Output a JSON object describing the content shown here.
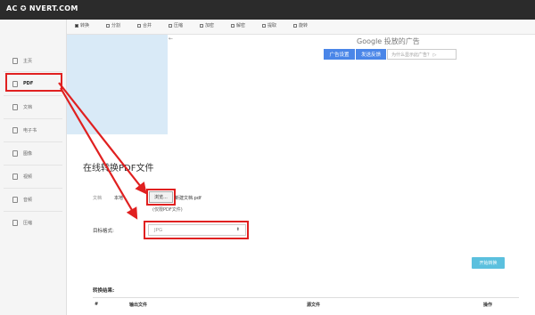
{
  "brand": "AC ✪ NVERT.COM",
  "tabs": [
    {
      "label": "转换",
      "active": true
    },
    {
      "label": "分割",
      "active": false
    },
    {
      "label": "合并",
      "active": false
    },
    {
      "label": "压缩",
      "active": false
    },
    {
      "label": "加密",
      "active": false
    },
    {
      "label": "解密",
      "active": false
    },
    {
      "label": "提取",
      "active": false
    },
    {
      "label": "旋转",
      "active": false
    }
  ],
  "sidebar": {
    "items": [
      {
        "label": "主页",
        "icon": "home-icon"
      },
      {
        "label": "PDF",
        "icon": "pdf-file-icon"
      },
      {
        "label": "文档",
        "icon": "document-icon"
      },
      {
        "label": "电子书",
        "icon": "ebook-icon"
      },
      {
        "label": "图像",
        "icon": "image-icon"
      },
      {
        "label": "视频",
        "icon": "video-icon"
      },
      {
        "label": "音频",
        "icon": "audio-icon"
      },
      {
        "label": "压缩",
        "icon": "archive-icon"
      }
    ]
  },
  "ad": {
    "google": "Google 投放的广告",
    "settings_btn": "广告设置",
    "feedback_btn": "发送反馈",
    "why_text": "为什么显示此广告？ ▷"
  },
  "main": {
    "title": "在线转换PDF文件",
    "source_seg1": "文档",
    "source_seg2": "本地",
    "browse_btn": "浏览...",
    "file_name": "新建文档.pdf",
    "file_hint": "(仅限PDF文件)",
    "target_label": "目标格式:",
    "target_value": "JPG",
    "start_btn": "开始转换",
    "result_label": "转换结果:",
    "table_headers": [
      "#",
      "输出文件",
      "源文件",
      "操作"
    ]
  },
  "colors": {
    "highlight": "#e02020",
    "accent": "#5bc0de",
    "ad_blue": "#4a86e8"
  }
}
